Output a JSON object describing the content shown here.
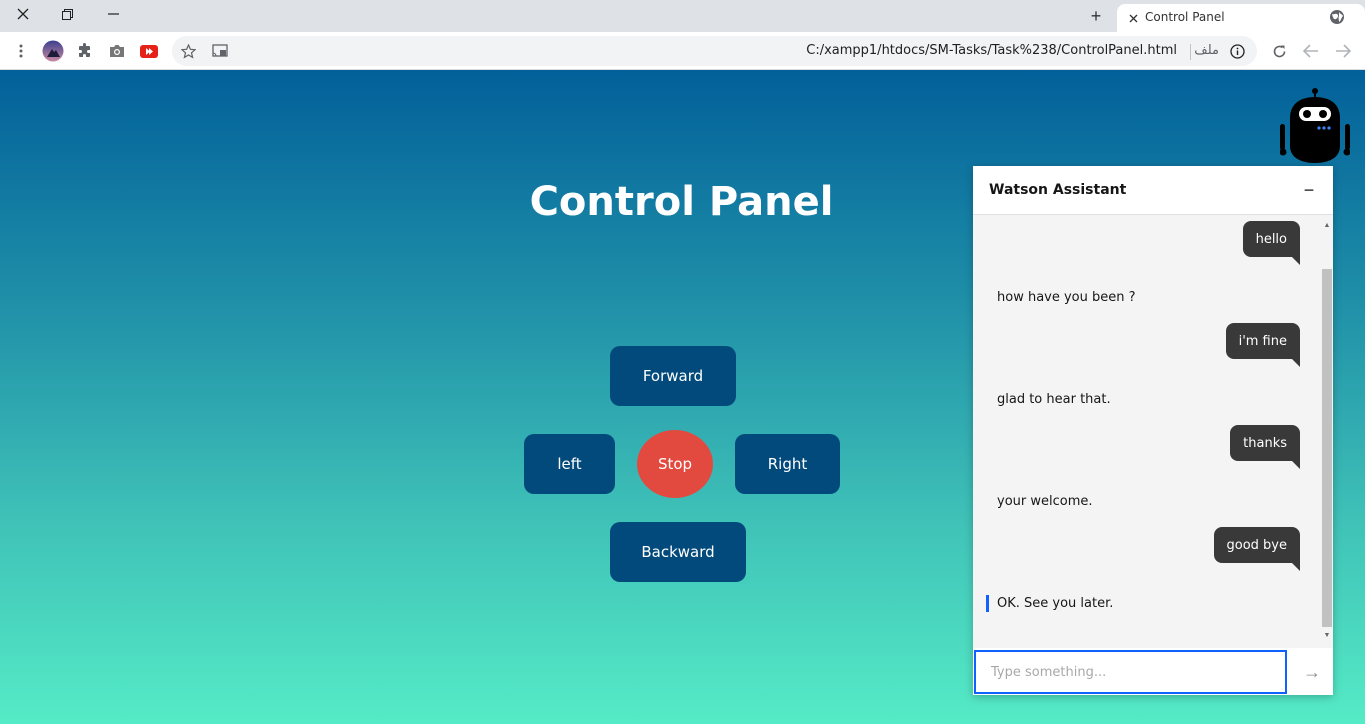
{
  "browser": {
    "tab_title": "Control Panel",
    "new_tab_symbol": "+",
    "url": "C:/xampp1/htdocs/SM-Tasks/Task%238/ControlPanel.html",
    "site_label": "ملف",
    "icons": [
      "close-icon",
      "restore-icon",
      "minimize-icon",
      "menu-icon",
      "profile-icon",
      "extensions-icon",
      "camera-icon",
      "youtube-icon",
      "bookmark-star-icon",
      "cast-icon",
      "info-icon",
      "reload-icon",
      "back-icon",
      "forward-icon",
      "globe-icon"
    ]
  },
  "page": {
    "title": "Control Panel",
    "controls": {
      "forward": "Forward",
      "left": "left",
      "stop": "Stop",
      "right": "Right",
      "backward": "Backward"
    },
    "colors": {
      "button": "#034a7c",
      "stop": "#e34a3f"
    }
  },
  "chat": {
    "title": "Watson Assistant",
    "minimize_symbol": "−",
    "messages": [
      {
        "from": "user",
        "text": "hello"
      },
      {
        "from": "bot",
        "text": "how have you been ?"
      },
      {
        "from": "user",
        "text": "i'm fine"
      },
      {
        "from": "bot",
        "text": "glad to hear that."
      },
      {
        "from": "user",
        "text": "thanks"
      },
      {
        "from": "bot",
        "text": "your welcome."
      },
      {
        "from": "user",
        "text": "good bye"
      },
      {
        "from": "bot",
        "text": "OK. See you later."
      }
    ],
    "input_placeholder": "Type something...",
    "send_symbol": "→"
  }
}
